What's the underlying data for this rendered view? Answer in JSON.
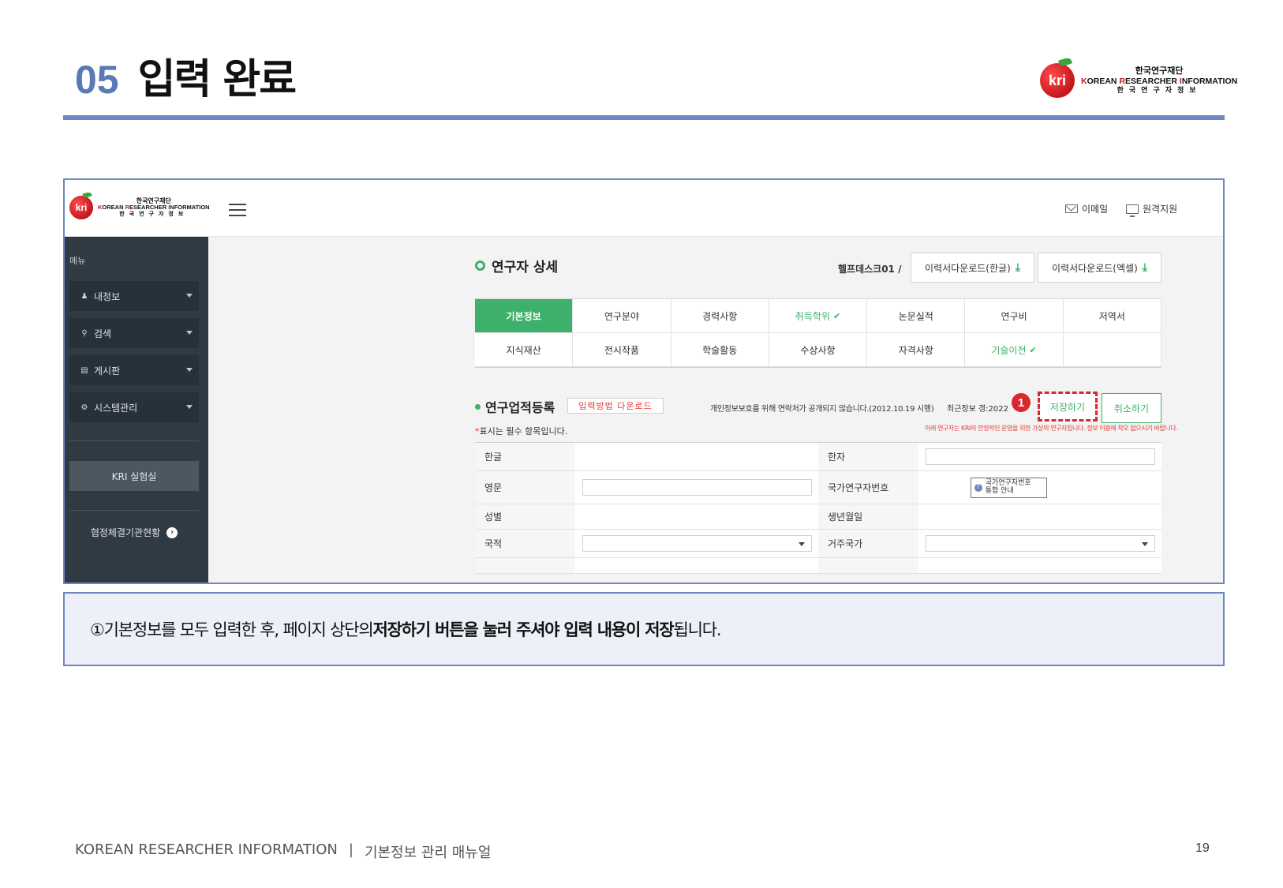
{
  "slide": {
    "number": "05",
    "title": "입력 완료",
    "footer_brand": "KOREAN RESEARCHER INFORMATION",
    "footer_sep": "|",
    "footer_doc": "기본정보 관리 매뉴얼",
    "page": "19"
  },
  "brand": {
    "apple": "kri",
    "ko": "한국연구재단",
    "en_k": "K",
    "en_orean": "OREAN ",
    "en_r": "R",
    "en_esearcher": "ESEARCHER ",
    "en_i": "I",
    "en_nformation": "NFORMATION",
    "spaced": "한국연구자정보"
  },
  "app": {
    "top_links": {
      "email": "이메일",
      "remote": "원격지원"
    },
    "sidebar": {
      "menu_label": "메뉴",
      "items": [
        {
          "label": "내정보",
          "icon": "user-icon"
        },
        {
          "label": "검색",
          "icon": "search-icon"
        },
        {
          "label": "게시판",
          "icon": "clipboard-icon"
        },
        {
          "label": "시스템관리",
          "icon": "gear-icon"
        }
      ],
      "lab_button": "KRI 실험실",
      "status_link": "협정체결기관현황"
    },
    "main": {
      "title": "연구자 상세",
      "helpdesk": "헬프데스크01 /",
      "download_hangul": "이력서다운로드(한글)",
      "download_excel": "이력서다운로드(엑셀)",
      "tabs_row1": [
        {
          "label": "기본정보",
          "active": true,
          "check": ""
        },
        {
          "label": "연구분야",
          "active": false,
          "check": ""
        },
        {
          "label": "경력사항",
          "active": false,
          "check": ""
        },
        {
          "label": "취득학위",
          "active": false,
          "check": "✔"
        },
        {
          "label": "논문실적",
          "active": false,
          "check": ""
        },
        {
          "label": "연구비",
          "active": false,
          "check": ""
        },
        {
          "label": "저역서",
          "active": false,
          "check": ""
        }
      ],
      "tabs_row2": [
        {
          "label": "지식재산",
          "check": ""
        },
        {
          "label": "전시작품",
          "check": ""
        },
        {
          "label": "학술활동",
          "check": ""
        },
        {
          "label": "수상사항",
          "check": ""
        },
        {
          "label": "자격사항",
          "check": ""
        },
        {
          "label": "기술이전",
          "check": "✔"
        },
        {
          "label": "",
          "check": ""
        }
      ],
      "section_title": "연구업적등록",
      "howto_button": "입력방법 다운로드",
      "privacy_note": "개인정보보호를 위해 연락처가 공개되지 않습니다.(2012.10.19 시행)",
      "recent_note": "최근정보 갱:2022",
      "marker": "1",
      "save_button": "저장하기",
      "cancel_button": "취소하기",
      "required_star": "*",
      "required_note": "표시는 필수 항목입니다.",
      "warning_note": "이래 연구자는 KRI의 안정적인 운영을 위한 가상의 연구자입니다. 정보 이용에 착오 없으시기 바랍니다.",
      "form": {
        "hangul": "한글",
        "hanja": "한자",
        "english": "영문",
        "national_id": "국가연구자번호",
        "national_id_help_1": "국가연구자번호",
        "national_id_help_2": "통합 안내",
        "gender": "성별",
        "birth": "생년월일",
        "nationality": "국적",
        "residence": "거주국가"
      }
    }
  },
  "caption": {
    "prefix": "①기본정보를 모두 입력한 후, 페이지 상단의 ",
    "bold": "저장하기 버튼을 눌러 주셔야 입력 내용이 저장",
    "suffix": "됩니다."
  },
  "colors": {
    "accent_green": "#3db06b",
    "accent_blue": "#6f86c0",
    "marker_red": "#d7282f"
  }
}
